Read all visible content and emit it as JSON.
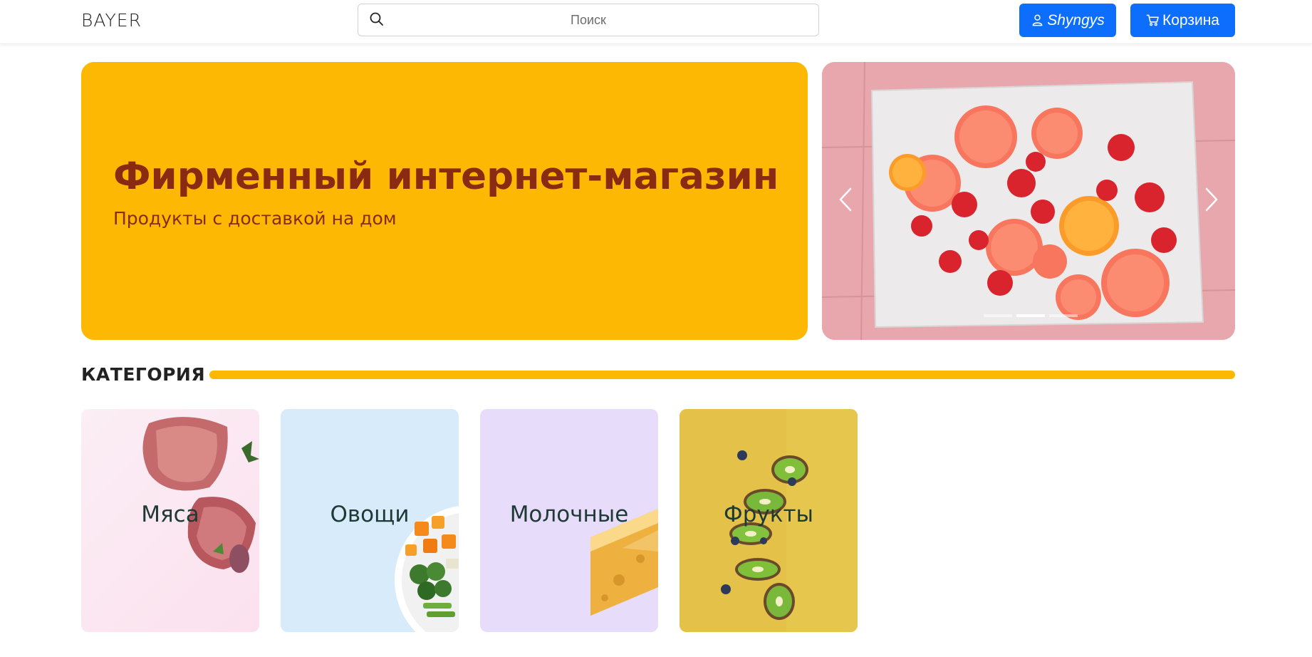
{
  "header": {
    "logo": "BAYER",
    "search": {
      "placeholder": "Поиск",
      "value": ""
    },
    "user_button": "Shyngys",
    "cart_button": "Корзина"
  },
  "hero": {
    "title": "Фирменный интернет-магазин",
    "subtitle": "Продукты с доставкой на дом"
  },
  "carousel": {
    "slide_count": 3,
    "active_slide": 2
  },
  "categories_section": {
    "title": "КАТЕГОРИЯ",
    "items": [
      {
        "label": "Мяса"
      },
      {
        "label": "Овощи"
      },
      {
        "label": "Молочные"
      },
      {
        "label": "Фрукты"
      }
    ]
  },
  "colors": {
    "accent_yellow": "#fdb803",
    "hero_text": "#8a2a12",
    "button_blue": "#0d6efd",
    "card_meat_bg": "#fbe6f0",
    "card_veg_bg": "#d7ebfa",
    "card_dairy_bg": "#e8dcfb",
    "card_fruit_bg": "#e3c243"
  },
  "icons": {
    "search": "search-icon",
    "user": "user-icon",
    "cart": "cart-icon",
    "prev": "chevron-left-icon",
    "next": "chevron-right-icon"
  }
}
